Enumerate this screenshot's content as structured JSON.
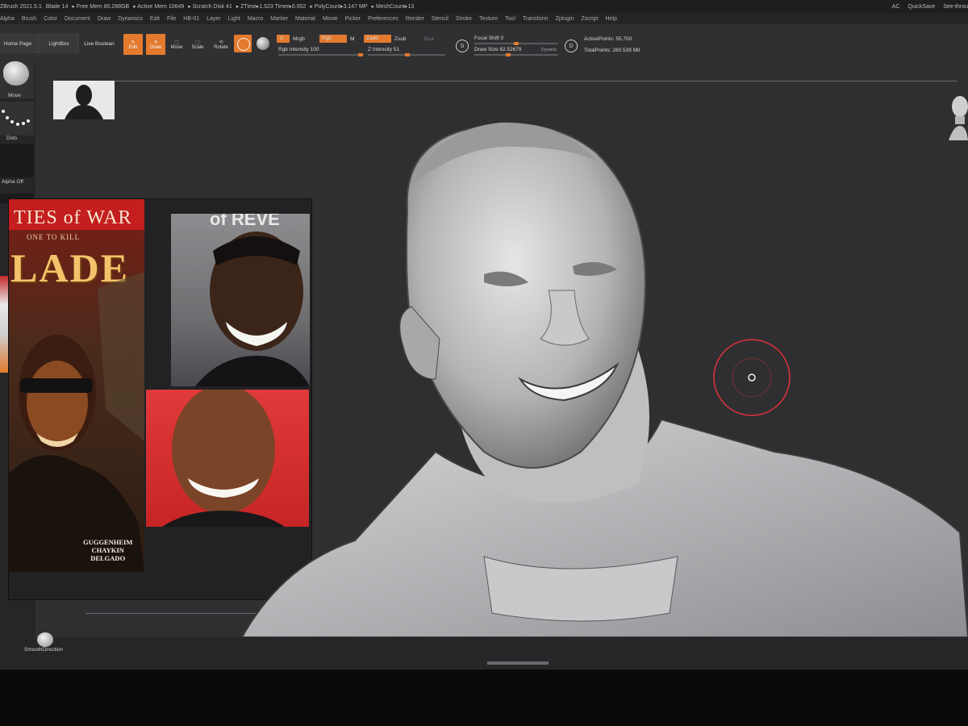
{
  "statusbar": {
    "app": "ZBrush 2021.5.1",
    "doc": "Blade 14",
    "free_mem": "▸ Free Mem 80.288GB",
    "active_mem": "▸ Active Mem 10649",
    "scratch": "▸ Scratch Disk 41",
    "ztime": "▸ ZTime▸1.523 Timer▸0.002",
    "polycount": "▸ PolyCount▸3.147 MP",
    "meshcount": "▸ MeshCount▸13",
    "ac": "AC",
    "quicksave": "QuickSave",
    "seethrough": "See-throu"
  },
  "menu": [
    "Alpha",
    "Brush",
    "Color",
    "Document",
    "Draw",
    "Dynamics",
    "Edit",
    "File",
    "HB-01",
    "Layer",
    "Light",
    "Macro",
    "Marker",
    "Material",
    "Movie",
    "Picker",
    "Preferences",
    "Render",
    "Stencil",
    "Stroke",
    "Texture",
    "Tool",
    "Transform",
    "Zplugin",
    "Zscript",
    "Help"
  ],
  "toolbar": {
    "home": "Home Page",
    "lightbox": "LightBox",
    "live_boolean": "Live Boolean",
    "edit": "Edit",
    "draw": "Draw",
    "move": "Move",
    "scale": "Scale",
    "rotate": "Rotate",
    "a": "A",
    "mrgb": "Mrgb",
    "rgb": "Rgb",
    "m": "M",
    "zadd": "Zadd",
    "zsub": "Zsub",
    "zcut": "Zcut",
    "rgb_intensity": "Rgb Intensity 100",
    "z_intensity": "Z Intensity 51",
    "focal_shift": "Focal Shift 0",
    "draw_size": "Draw Size 82.52679",
    "dynamic": "Dynamic",
    "active_points": "ActivePoints: 55,750",
    "total_points": "TotalPoints: 260.539 Mil",
    "s_label": "S",
    "d_label": "D"
  },
  "sliders": {
    "rgb_intensity": 1.0,
    "z_intensity": 0.51,
    "focal_shift": 0.5,
    "draw_size": 0.4
  },
  "leftpanel": {
    "move": "Move",
    "dots": "Dots",
    "alpha_off": "Alpha Off"
  },
  "reference": {
    "series": "TIES of WAR",
    "subtitle": "ONE TO KILL",
    "title": "LADE",
    "credits": [
      "GUGGENHEIM",
      "CHAYKIN",
      "DELGADO"
    ],
    "photo_backdrop": "of REVE"
  },
  "bottom": {
    "smooth_direction": "SmoothDirection"
  },
  "colors": {
    "accent": "#e37a2d",
    "cursor": "#e0323a"
  }
}
